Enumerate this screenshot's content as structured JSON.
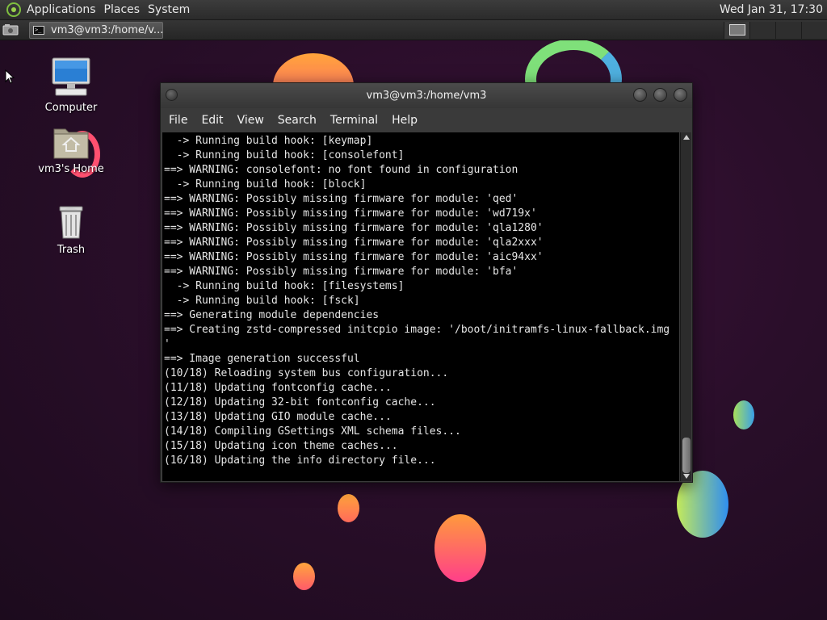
{
  "top_panel": {
    "menus": [
      "Applications",
      "Places",
      "System"
    ],
    "clock": "Wed Jan 31, 17:30"
  },
  "taskbar": {
    "window_label": "vm3@vm3:/home/v..."
  },
  "desktop_icons": [
    {
      "label": "Computer",
      "icon": "computer-icon"
    },
    {
      "label": "vm3's Home",
      "icon": "home-folder-icon"
    },
    {
      "label": "Trash",
      "icon": "trash-icon"
    }
  ],
  "terminal": {
    "title": "vm3@vm3:/home/vm3",
    "menu": [
      "File",
      "Edit",
      "View",
      "Search",
      "Terminal",
      "Help"
    ],
    "lines": [
      "  -> Running build hook: [keymap]",
      "  -> Running build hook: [consolefont]",
      "==> WARNING: consolefont: no font found in configuration",
      "  -> Running build hook: [block]",
      "==> WARNING: Possibly missing firmware for module: 'qed'",
      "==> WARNING: Possibly missing firmware for module: 'wd719x'",
      "==> WARNING: Possibly missing firmware for module: 'qla1280'",
      "==> WARNING: Possibly missing firmware for module: 'qla2xxx'",
      "==> WARNING: Possibly missing firmware for module: 'aic94xx'",
      "==> WARNING: Possibly missing firmware for module: 'bfa'",
      "  -> Running build hook: [filesystems]",
      "  -> Running build hook: [fsck]",
      "==> Generating module dependencies",
      "==> Creating zstd-compressed initcpio image: '/boot/initramfs-linux-fallback.img",
      "'",
      "==> Image generation successful",
      "(10/18) Reloading system bus configuration...",
      "(11/18) Updating fontconfig cache...",
      "(12/18) Updating 32-bit fontconfig cache...",
      "(13/18) Updating GIO module cache...",
      "(14/18) Compiling GSettings XML schema files...",
      "(15/18) Updating icon theme caches...",
      "(16/18) Updating the info directory file..."
    ]
  },
  "colors": {
    "terminal_bg": "#000000",
    "terminal_fg": "#e6e6e6",
    "panel_bg": "#2b2b2b",
    "desktop_bg": "#2a0e2a"
  }
}
